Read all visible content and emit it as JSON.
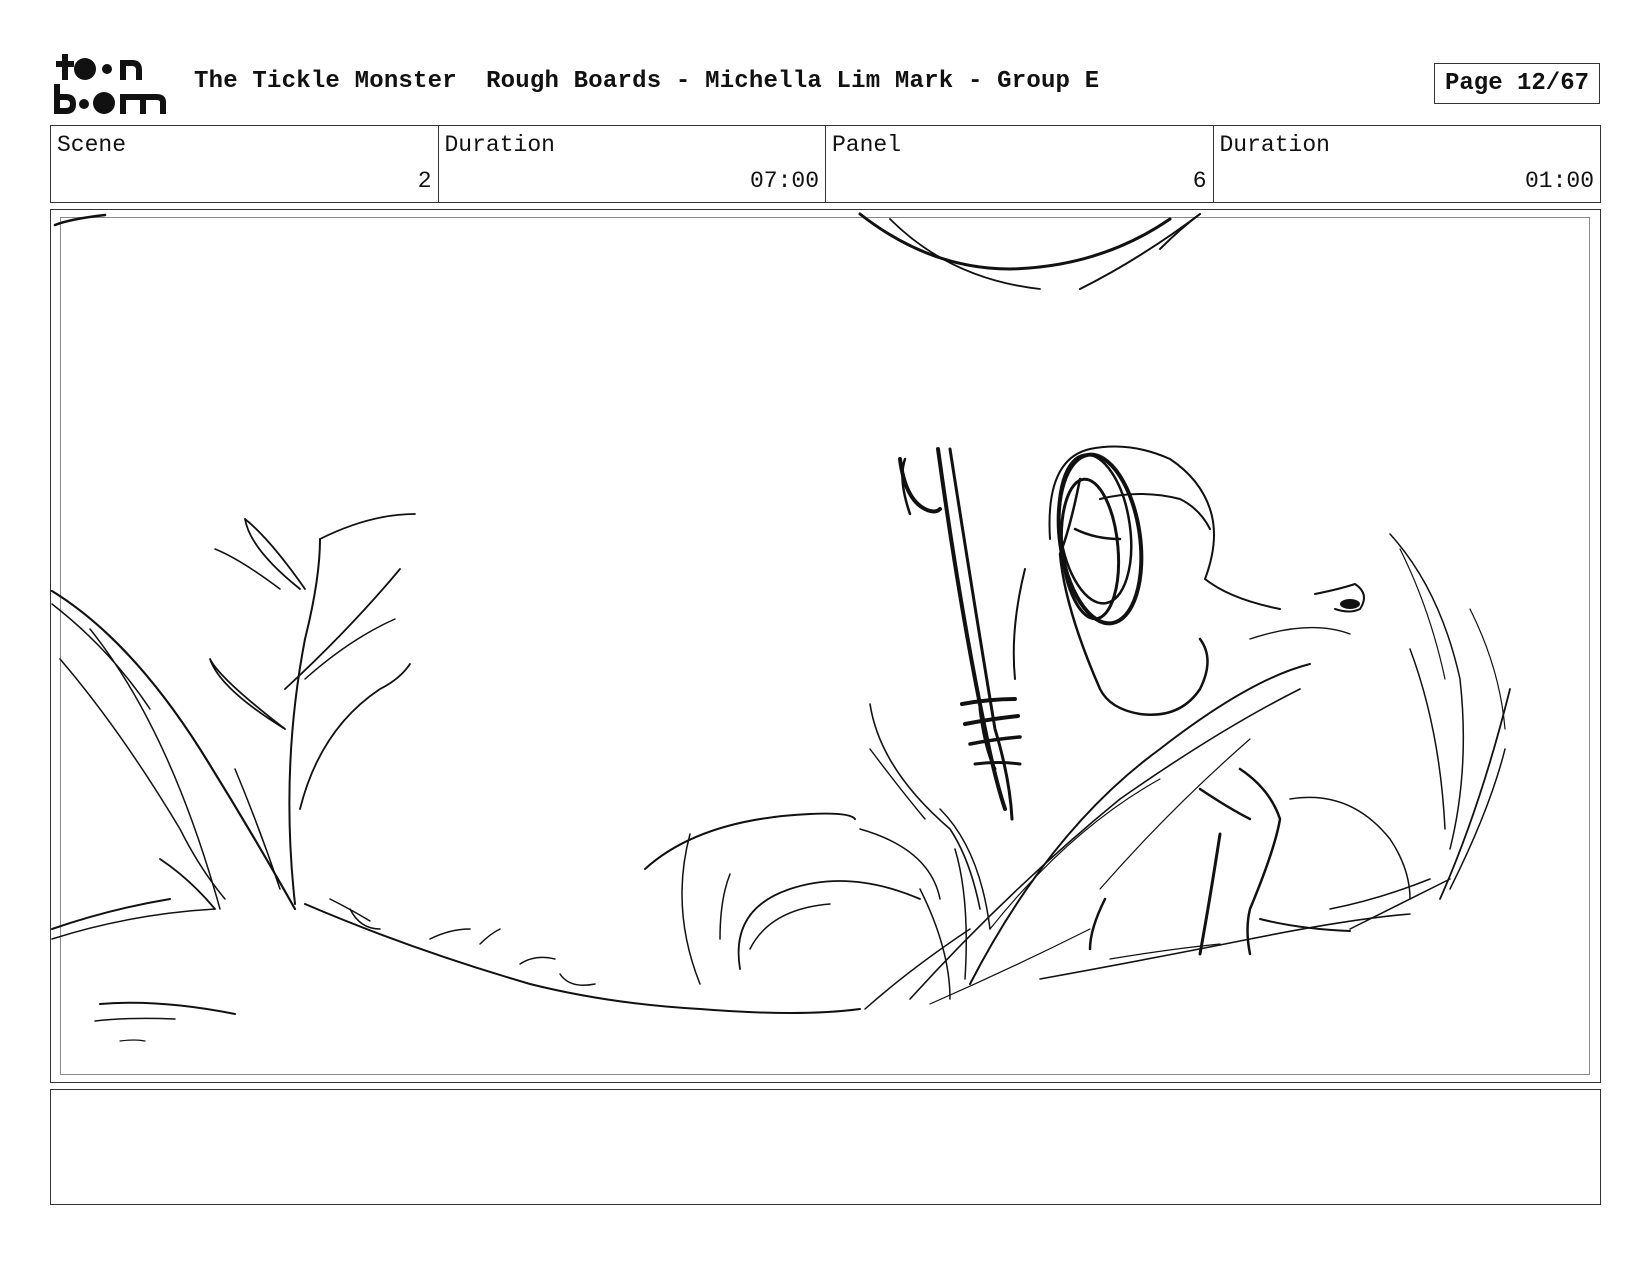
{
  "logo": {
    "line1": "toon",
    "line2": "boom"
  },
  "header": {
    "project": "The Tickle Monster",
    "subtitle": "Rough Boards - Michella Lim Mark - Group E",
    "page": "Page 12/67"
  },
  "info": [
    {
      "label": "Scene",
      "value": "2"
    },
    {
      "label": "Duration",
      "value": "07:00"
    },
    {
      "label": "Panel",
      "value": "6"
    },
    {
      "label": "Duration",
      "value": "01:00"
    }
  ],
  "panel": {
    "description": ""
  },
  "notes": {
    "text": ""
  }
}
